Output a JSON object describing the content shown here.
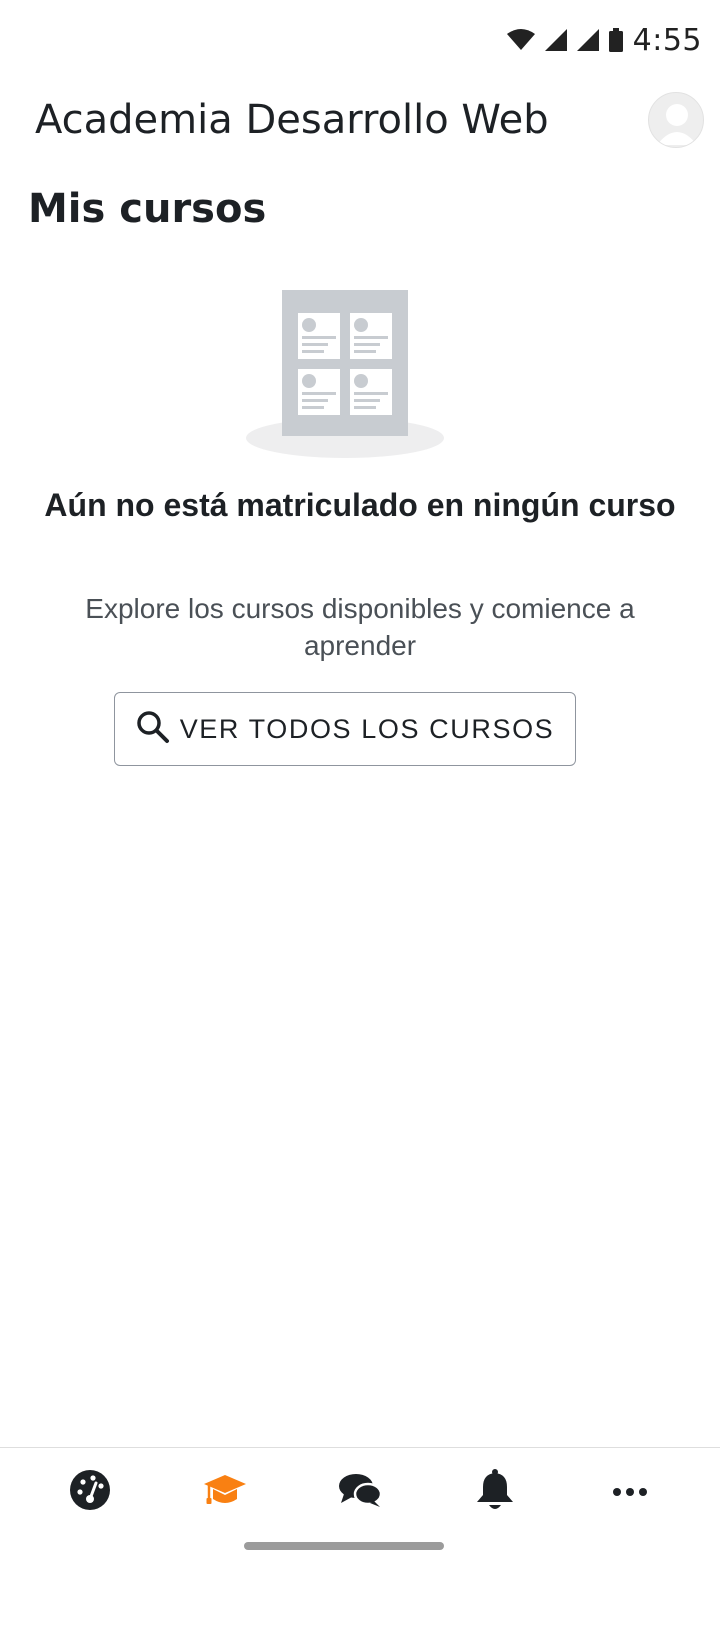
{
  "status_bar": {
    "time": "4:55",
    "icons": [
      "wifi-icon",
      "signal-icon",
      "signal-icon",
      "battery-icon"
    ]
  },
  "header": {
    "site_title": "Academia Desarrollo Web",
    "avatar_icon": "user-avatar-icon"
  },
  "page": {
    "title": "Mis cursos"
  },
  "empty_state": {
    "illustration_icon": "course-grid-illustration",
    "title": "Aún no está matriculado en ningún curso",
    "description": "Explore los cursos disponibles y comience a aprender",
    "button_label": "VER TODOS LOS CURSOS",
    "button_icon": "search-icon"
  },
  "bottom_nav": {
    "items": [
      {
        "icon": "dashboard-gauge-icon",
        "active": false
      },
      {
        "icon": "graduation-cap-icon",
        "active": true
      },
      {
        "icon": "chat-bubbles-icon",
        "active": false
      },
      {
        "icon": "bell-icon",
        "active": false
      },
      {
        "icon": "more-dots-icon",
        "active": false
      }
    ],
    "active_color": "#f98012",
    "inactive_color": "#1d2125"
  }
}
